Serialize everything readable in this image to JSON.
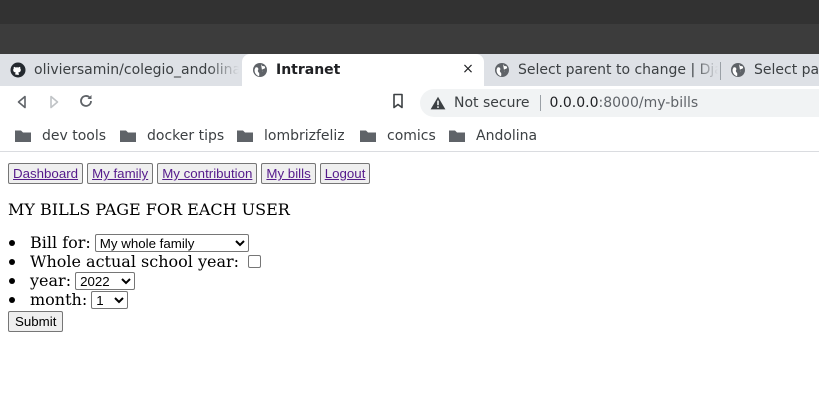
{
  "browser": {
    "tabs": [
      {
        "title": "oliviersamin/colegio_andolina",
        "icon": "github-icon",
        "active": false
      },
      {
        "title": "Intranet",
        "icon": "globe-icon",
        "active": true
      },
      {
        "title": "Select parent to change | Django",
        "icon": "globe-icon",
        "active": false
      },
      {
        "title": "Select parent",
        "icon": "globe-icon",
        "active": false
      }
    ],
    "close_glyph": "×",
    "address": {
      "security_label": "Not secure",
      "host": "0.0.0.0",
      "path": ":8000/my-bills"
    },
    "bookmarks": [
      "dev tools",
      "docker tips",
      "lombrizfeliz",
      "comics",
      "Andolina"
    ]
  },
  "page": {
    "nav": [
      "Dashboard",
      "My family",
      "My contribution",
      "My bills",
      "Logout"
    ],
    "heading": "MY BILLS PAGE FOR EACH USER",
    "form": {
      "bill_for_label": "Bill for:",
      "bill_for_value": "My whole family",
      "school_year_label": "Whole actual school year:",
      "school_year_checked": false,
      "year_label": "year:",
      "year_value": "2022",
      "month_label": "month:",
      "month_value": "1",
      "submit_label": "Submit"
    }
  }
}
